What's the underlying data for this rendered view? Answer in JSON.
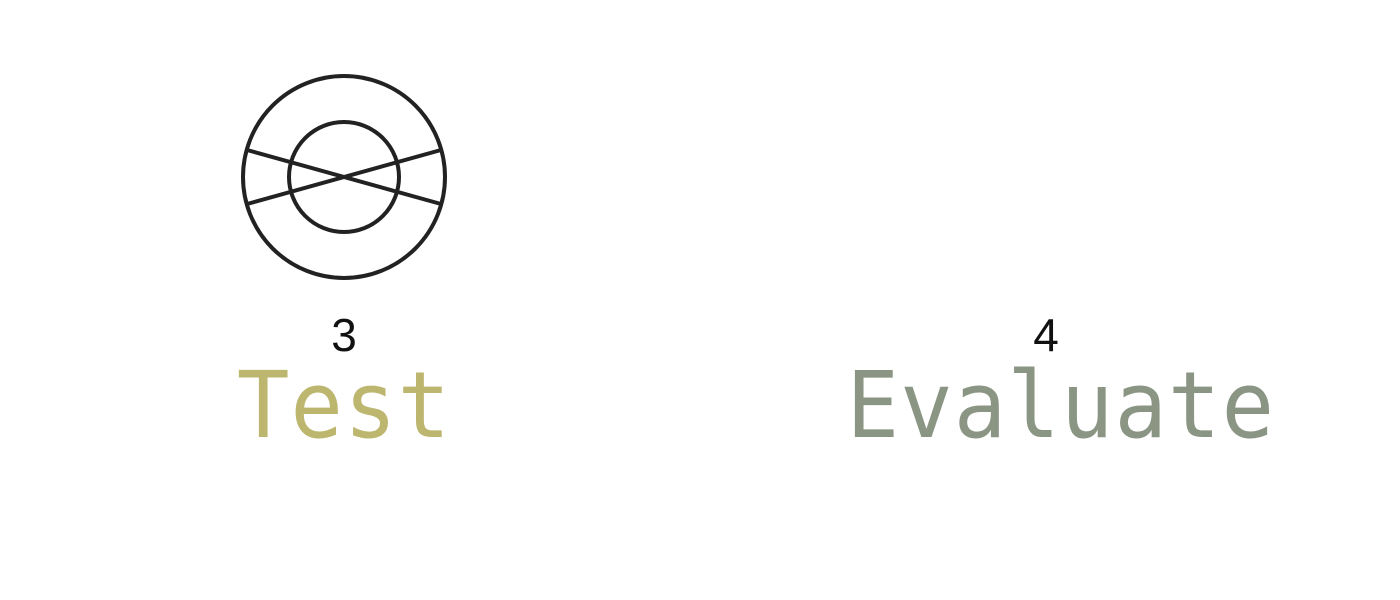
{
  "steps": [
    {
      "number": "3",
      "title": "Test",
      "title_color": "#bdb66f",
      "icon": "target-x-icon"
    },
    {
      "number": "4",
      "title": "Evaluate",
      "title_color": "#8a9584",
      "icon": ""
    }
  ],
  "colors": {
    "icon_stroke": "#222222",
    "number_text": "#111111",
    "background": "#ffffff"
  }
}
